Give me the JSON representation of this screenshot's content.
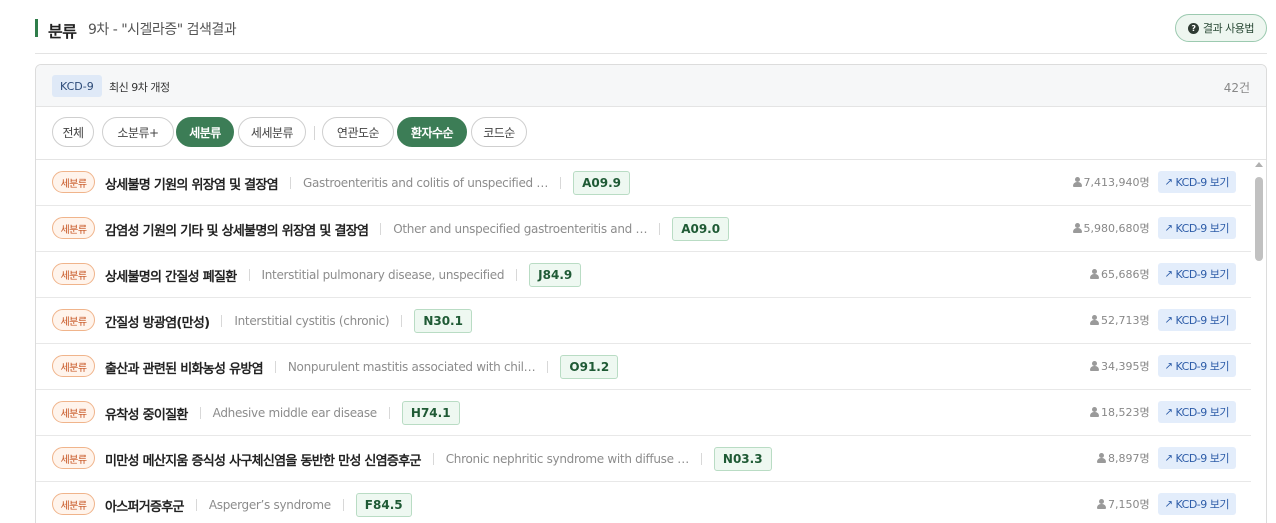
{
  "header": {
    "title": "분류",
    "subtitle": "9차 - \"시겔라증\" 검색결과",
    "usage_button": "결과 사용법"
  },
  "panel": {
    "badge": "KCD-9",
    "revision": "최신 9차 개정",
    "count": "42건"
  },
  "filters": [
    {
      "label": "전체",
      "active": false
    },
    {
      "label": "소분류+",
      "active": false
    },
    {
      "label": "세분류",
      "active": true
    },
    {
      "label": "세세분류",
      "active": false
    },
    {
      "label": "연관도순",
      "active": false
    },
    {
      "label": "환자수순",
      "active": true
    },
    {
      "label": "코드순",
      "active": false
    }
  ],
  "rows": [
    {
      "tag": "세분류",
      "name": "상세불명 기원의 위장염 및 결장염",
      "en": "Gastroenteritis and colitis of unspecified …",
      "code": "A09.9",
      "patients": "7,413,940명",
      "button": "KCD-9 보기"
    },
    {
      "tag": "세분류",
      "name": "감염성 기원의 기타 및 상세불명의 위장염 및 결장염",
      "en": "Other and unspecified gastroenteritis and …",
      "code": "A09.0",
      "patients": "5,980,680명",
      "button": "KCD-9 보기"
    },
    {
      "tag": "세분류",
      "name": "상세불명의 간질성 폐질환",
      "en": "Interstitial pulmonary disease, unspecified",
      "code": "J84.9",
      "patients": "65,686명",
      "button": "KCD-9 보기"
    },
    {
      "tag": "세분류",
      "name": "간질성 방광염(만성)",
      "en": "Interstitial cystitis (chronic)",
      "code": "N30.1",
      "patients": "52,713명",
      "button": "KCD-9 보기"
    },
    {
      "tag": "세분류",
      "name": "출산과 관련된 비화농성 유방염",
      "en": "Nonpurulent mastitis associated with chil…",
      "code": "O91.2",
      "patients": "34,395명",
      "button": "KCD-9 보기"
    },
    {
      "tag": "세분류",
      "name": "유착성 중이질환",
      "en": "Adhesive middle ear disease",
      "code": "H74.1",
      "patients": "18,523명",
      "button": "KCD-9 보기"
    },
    {
      "tag": "세분류",
      "name": "미만성 메산지움 증식성 사구체신염을 동반한 만성 신염증후군",
      "en": "Chronic nephritic syndrome with diffuse …",
      "code": "N03.3",
      "patients": "8,897명",
      "button": "KCD-9 보기"
    },
    {
      "tag": "세분류",
      "name": "아스퍼거증후군",
      "en": "Asperger’s syndrome",
      "code": "F84.5",
      "patients": "7,150명",
      "button": "KCD-9 보기"
    }
  ]
}
